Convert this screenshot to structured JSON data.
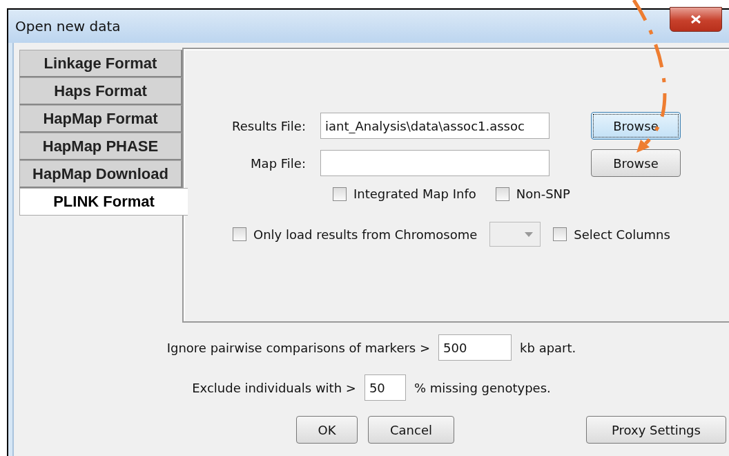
{
  "window": {
    "title": "Open new data"
  },
  "tabs": [
    {
      "label": "Linkage Format",
      "selected": false
    },
    {
      "label": "Haps Format",
      "selected": false
    },
    {
      "label": "HapMap Format",
      "selected": false
    },
    {
      "label": "HapMap PHASE",
      "selected": false
    },
    {
      "label": "HapMap Download",
      "selected": false
    },
    {
      "label": "PLINK Format",
      "selected": true
    }
  ],
  "files": [
    {
      "label": "Results File:",
      "value": "iant_Analysis\\data\\assoc1.assoc",
      "button": "Browse",
      "focused": true
    },
    {
      "label": "Map File:",
      "button": "Browse",
      "focused": false
    }
  ],
  "options": [
    {
      "label": "Integrated Map Info",
      "checked": false
    },
    {
      "label": "Non-SNP",
      "checked": false
    }
  ],
  "chromosome": {
    "label": "Only load results from Chromosome",
    "checked": false
  },
  "select_columns": {
    "label": "Select Columns",
    "checked": false
  },
  "pairwise": {
    "before": "Ignore pairwise comparisons of markers >",
    "value": "500",
    "after": "kb apart."
  },
  "missing": {
    "before": "Exclude individuals with >",
    "value": "50",
    "after": "% missing genotypes."
  },
  "buttons": [
    "OK",
    "Cancel"
  ],
  "proxy_button": "Proxy Settings"
}
